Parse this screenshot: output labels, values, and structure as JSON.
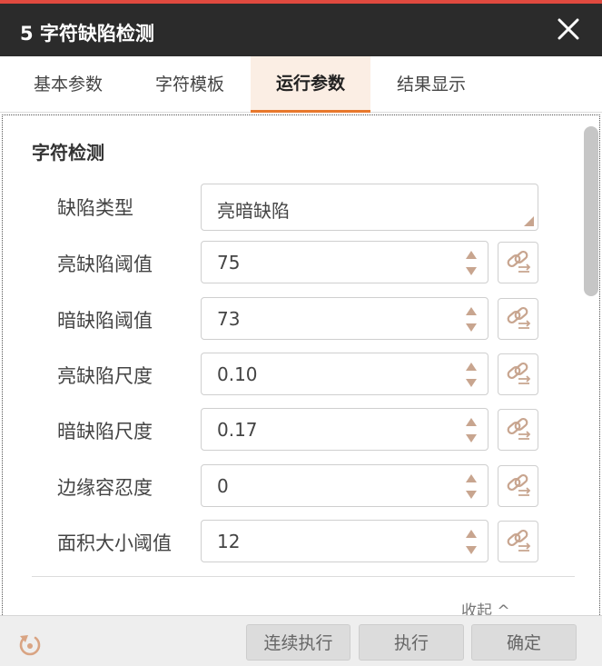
{
  "window": {
    "title": "5 字符缺陷检测",
    "close_icon": "close-icon"
  },
  "tabs": [
    {
      "label": "基本参数",
      "active": false
    },
    {
      "label": "字符模板",
      "active": false
    },
    {
      "label": "运行参数",
      "active": true
    },
    {
      "label": "结果显示",
      "active": false
    }
  ],
  "section": {
    "title": "字符检测"
  },
  "fields": [
    {
      "label": "缺陷类型",
      "type": "select",
      "value": "亮暗缺陷"
    },
    {
      "label": "亮缺陷阈值",
      "type": "number",
      "value": "75"
    },
    {
      "label": "暗缺陷阈值",
      "type": "number",
      "value": "73"
    },
    {
      "label": "亮缺陷尺度",
      "type": "number",
      "value": "0.10"
    },
    {
      "label": "暗缺陷尺度",
      "type": "number",
      "value": "0.17"
    },
    {
      "label": "边缘容忍度",
      "type": "number",
      "value": "0"
    },
    {
      "label": "面积大小阈值",
      "type": "number",
      "value": "12"
    }
  ],
  "collapse": {
    "label": "收起 ^"
  },
  "footer": {
    "reset_icon": "reset-icon",
    "buttons": [
      {
        "label": "连续执行"
      },
      {
        "label": "执行"
      },
      {
        "label": "确定"
      }
    ]
  },
  "colors": {
    "title_bar": "#2b2b2b",
    "title_accent": "#e04a3f",
    "tab_active_bg": "#fbeee4",
    "tab_active_underline": "#e8782d",
    "icon_accent": "#c8a58f"
  }
}
